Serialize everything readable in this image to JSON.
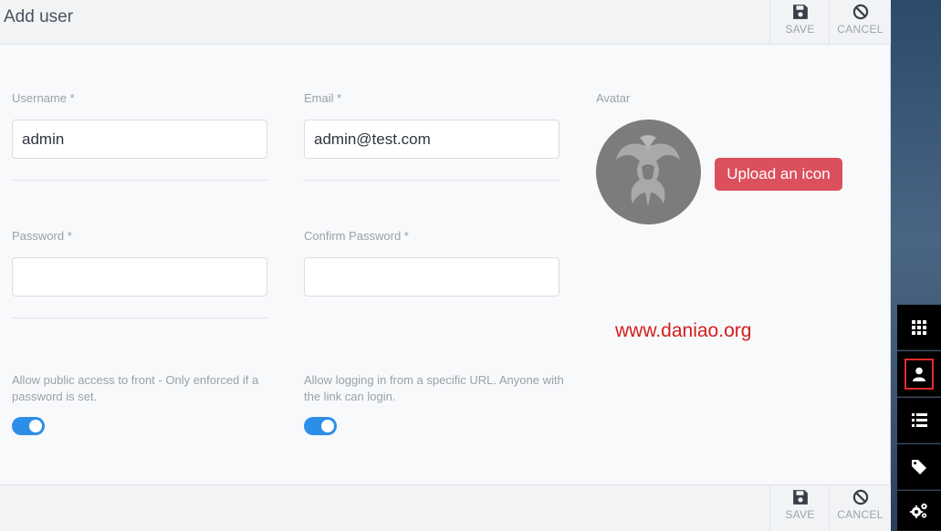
{
  "header": {
    "title": "Add user",
    "save_label": "SAVE",
    "cancel_label": "CANCEL",
    "save_icon": "floppy-disk-icon",
    "cancel_icon": "ban-icon"
  },
  "form": {
    "username": {
      "label": "Username *",
      "value": "admin"
    },
    "email": {
      "label": "Email *",
      "value": "admin@test.com"
    },
    "password": {
      "label": "Password *",
      "value": ""
    },
    "confirm_password": {
      "label": "Confirm Password *",
      "value": ""
    },
    "avatar": {
      "label": "Avatar",
      "upload_label": "Upload an icon"
    },
    "public_access": {
      "help": "Allow public access to front - Only enforced if a password is set.",
      "enabled": true
    },
    "url_login": {
      "help": "Allow logging in from a specific URL. Anyone with the link can login.",
      "enabled": true
    }
  },
  "watermark": "www.daniao.org",
  "footer": {
    "save_label": "SAVE",
    "cancel_label": "CANCEL"
  },
  "rail": {
    "items": [
      {
        "icon": "grid-icon",
        "active": false
      },
      {
        "icon": "user-icon",
        "active": true
      },
      {
        "icon": "list-icon",
        "active": false
      },
      {
        "icon": "tag-icon",
        "active": false
      },
      {
        "icon": "gears-icon",
        "active": false
      }
    ]
  },
  "colors": {
    "accent": "#2d8ee8",
    "upload_button": "#dc4f5c",
    "watermark": "#d41d1d",
    "rail_highlight": "#e32a2a"
  }
}
